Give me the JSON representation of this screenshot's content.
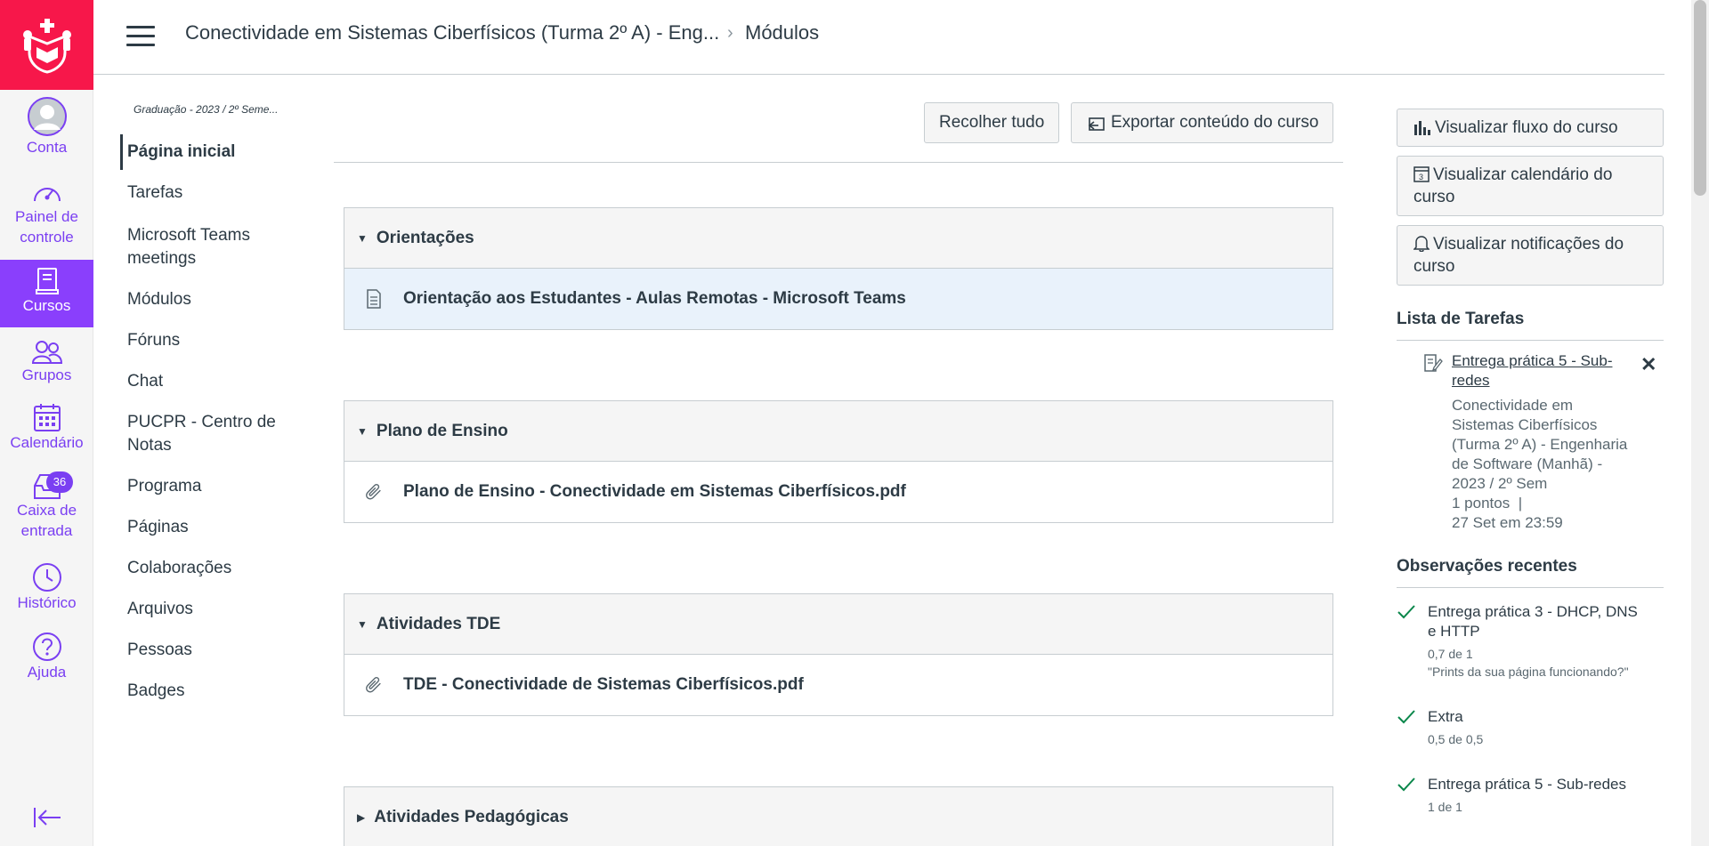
{
  "global_nav": {
    "items": [
      {
        "label": "Conta",
        "icon": "avatar-icon"
      },
      {
        "label": "Painel de controle",
        "icon": "dashboard-icon"
      },
      {
        "label": "Cursos",
        "icon": "courses-icon",
        "active": true
      },
      {
        "label": "Grupos",
        "icon": "groups-icon"
      },
      {
        "label": "Calendário",
        "icon": "calendar-icon"
      },
      {
        "label": "Caixa de entrada",
        "icon": "inbox-icon",
        "badge": "36"
      },
      {
        "label": "Histórico",
        "icon": "history-icon"
      },
      {
        "label": "Ajuda",
        "icon": "help-icon"
      }
    ],
    "brand_color": "#f7174a",
    "accent_color": "#8a3ffc"
  },
  "header": {
    "course": "Conectividade em Sistemas Ciberfísicos (Turma 2º A) - Eng...",
    "separator": "›",
    "page": "Módulos"
  },
  "course_nav": {
    "term": "Graduação - 2023 / 2º Seme...",
    "items": [
      "Página inicial",
      "Tarefas",
      "Microsoft Teams meetings",
      "Módulos",
      "Fóruns",
      "Chat",
      "PUCPR - Centro de Notas",
      "Programa",
      "Páginas",
      "Colaborações",
      "Arquivos",
      "Pessoas",
      "Badges"
    ],
    "active": "Página inicial"
  },
  "toolbar": {
    "collapse_all": "Recolher tudo",
    "export": "Exportar conteúdo do curso"
  },
  "modules": [
    {
      "title": "Orientações",
      "expanded": true,
      "items": [
        {
          "title": "Orientação aos Estudantes - Aulas Remotas - Microsoft Teams",
          "icon": "page-icon"
        }
      ]
    },
    {
      "title": "Plano de Ensino",
      "expanded": true,
      "items": [
        {
          "title": "Plano de Ensino - Conectividade em Sistemas Ciberfísicos.pdf",
          "icon": "attachment-icon"
        }
      ]
    },
    {
      "title": "Atividades TDE",
      "expanded": true,
      "items": [
        {
          "title": "TDE - Conectividade de Sistemas Ciberfísicos.pdf",
          "icon": "attachment-icon"
        }
      ]
    },
    {
      "title": "Atividades Pedagógicas",
      "expanded": false,
      "items": []
    }
  ],
  "sidebar": {
    "buttons": [
      "Visualizar fluxo do curso",
      "Visualizar calendário do curso",
      "Visualizar notificações do curso"
    ],
    "todo_heading": "Lista de Tarefas",
    "todo": {
      "link": "Entrega prática 5 - Sub-redes",
      "context": "Conectividade em Sistemas Ciberfísicos (Turma 2º A) - Engenharia de Software (Manhã) - 2023 / 2º Sem",
      "points": "1 pontos",
      "sep": "|",
      "due": "27 Set em 23:59",
      "close": "✕"
    },
    "feedback_heading": "Observações recentes",
    "feedback": [
      {
        "title": "Entrega prática 3 - DHCP, DNS e HTTP",
        "score": "0,7 de 1",
        "comment": "\"Prints da sua página funcionando?\""
      },
      {
        "title": "Extra",
        "score": "0,5 de 0,5"
      },
      {
        "title": "Entrega prática 5 - Sub-redes",
        "score": "1 de 1"
      }
    ]
  }
}
